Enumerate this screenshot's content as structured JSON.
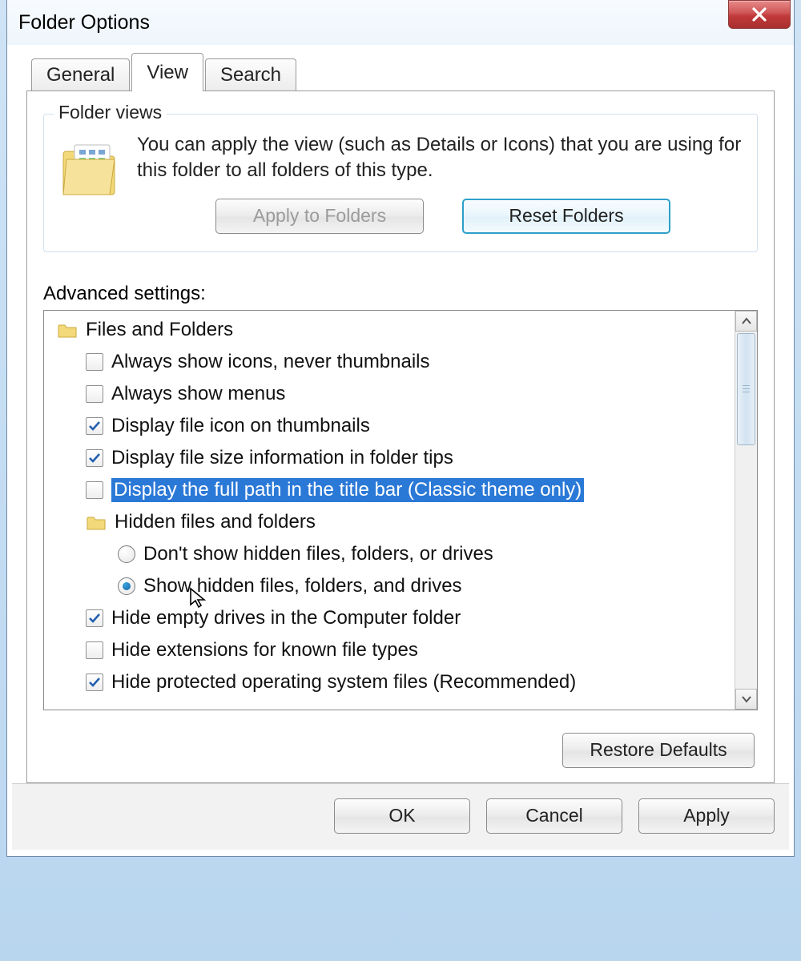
{
  "title": "Folder Options",
  "tabs": {
    "general": "General",
    "view": "View",
    "search": "Search"
  },
  "folderViews": {
    "legend": "Folder views",
    "text": "You can apply the view (such as Details or Icons) that you are using for this folder to all folders of this type.",
    "applyBtn": "Apply to Folders",
    "resetBtn": "Reset Folders"
  },
  "advancedLabel": "Advanced settings:",
  "tree": {
    "root": "Files and Folders",
    "items": [
      {
        "label": "Always show icons, never thumbnails",
        "checked": false
      },
      {
        "label": "Always show menus",
        "checked": false
      },
      {
        "label": "Display file icon on thumbnails",
        "checked": true
      },
      {
        "label": "Display file size information in folder tips",
        "checked": true
      },
      {
        "label": "Display the full path in the title bar (Classic theme only)",
        "checked": false,
        "selected": true
      }
    ],
    "hiddenGroup": "Hidden files and folders",
    "hiddenOptions": [
      {
        "label": "Don't show hidden files, folders, or drives",
        "checked": false
      },
      {
        "label": "Show hidden files, folders, and drives",
        "checked": true
      }
    ],
    "items2": [
      {
        "label": "Hide empty drives in the Computer folder",
        "checked": true
      },
      {
        "label": "Hide extensions for known file types",
        "checked": false
      },
      {
        "label": "Hide protected operating system files (Recommended)",
        "checked": true
      }
    ]
  },
  "restoreBtn": "Restore Defaults",
  "footer": {
    "ok": "OK",
    "cancel": "Cancel",
    "apply": "Apply"
  }
}
